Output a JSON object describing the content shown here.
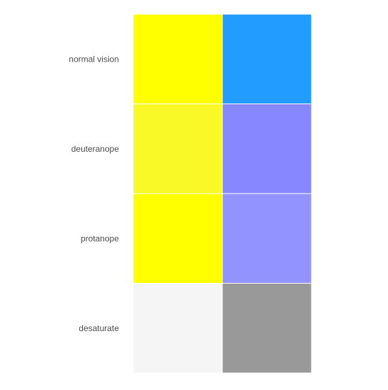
{
  "chart_data": {
    "type": "heatmap",
    "rows": [
      "normal vision",
      "deuteranope",
      "protanope",
      "desaturate"
    ],
    "columns": 2,
    "cells": [
      [
        "#FFFF00",
        "#229DFF"
      ],
      [
        "#F9F928",
        "#8787FF"
      ],
      [
        "#FFFF00",
        "#9393FF"
      ],
      [
        "#F5F5F5",
        "#999999"
      ]
    ],
    "grid": false,
    "legend": "none"
  }
}
